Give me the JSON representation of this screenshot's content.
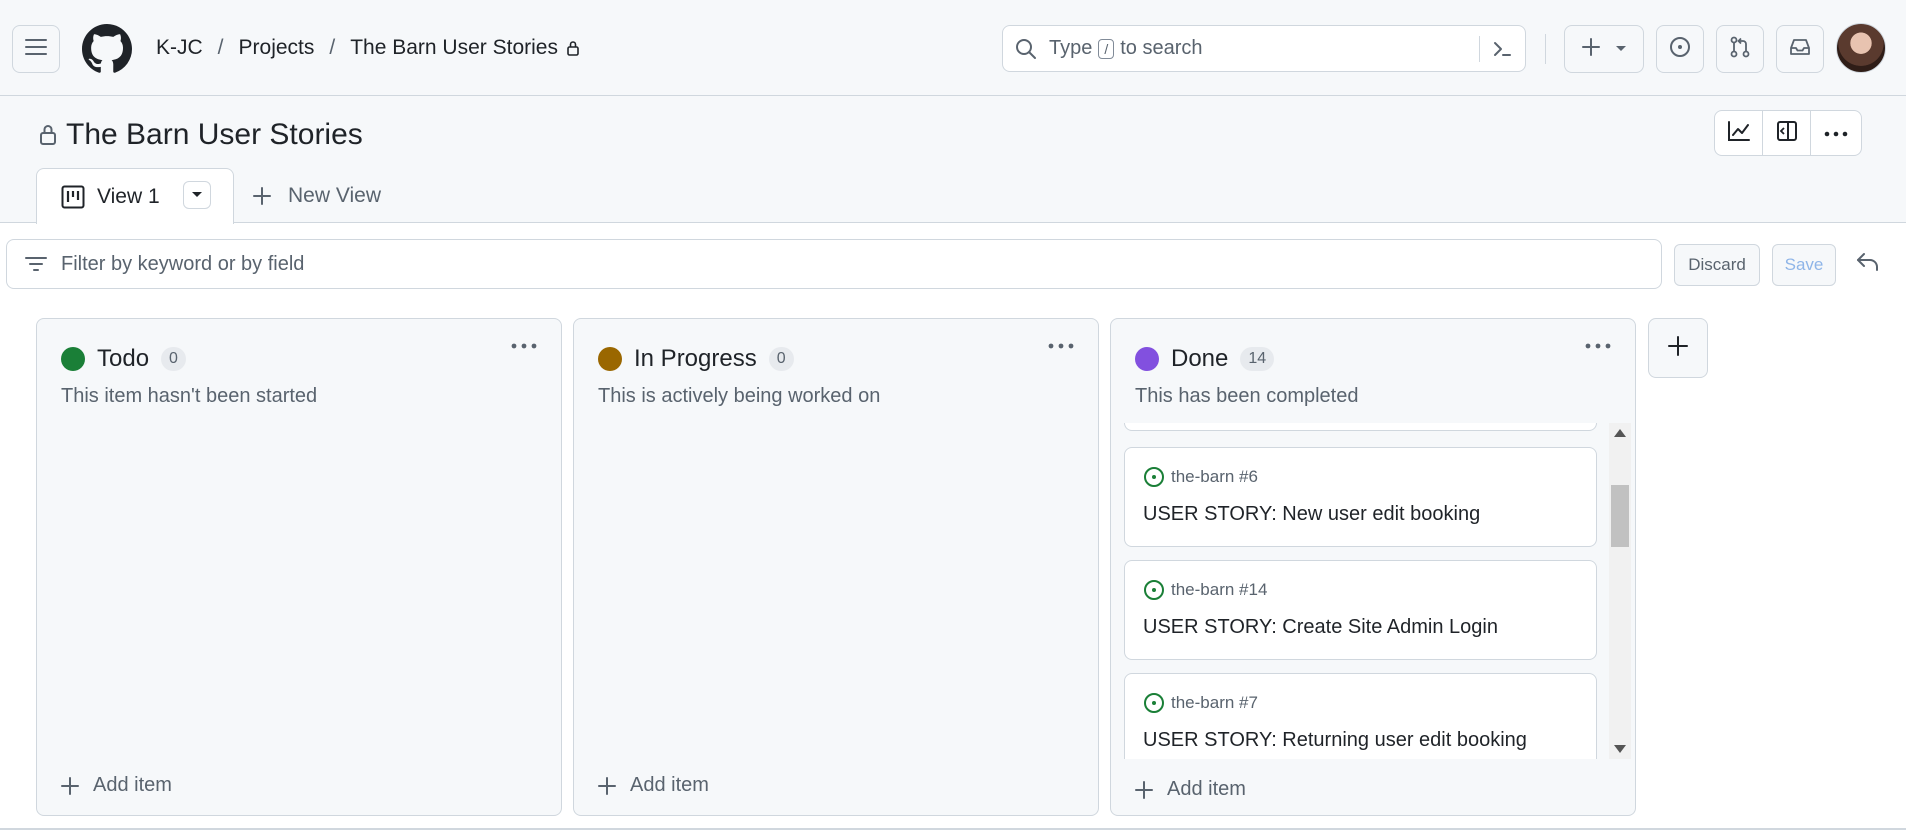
{
  "header": {
    "breadcrumbs": [
      {
        "label": "K-JC"
      },
      {
        "label": "Projects"
      },
      {
        "label": "The Barn User Stories"
      }
    ],
    "separator": "/",
    "search": {
      "prefix": "Type",
      "key": "/",
      "suffix": "to search"
    },
    "icons": {
      "menu": "hamburger-icon",
      "logo": "github-logo",
      "search": "search-icon",
      "command": "terminal-icon",
      "create": "plus-icon",
      "issues": "issue-opened-icon",
      "pulls": "git-pull-request-icon",
      "inbox": "inbox-icon"
    }
  },
  "project": {
    "title": "The Barn User Stories",
    "views": [
      {
        "label": "View 1",
        "active": true
      }
    ],
    "new_view_label": "New View"
  },
  "filter": {
    "placeholder": "Filter by keyword or by field",
    "discard_label": "Discard",
    "save_label": "Save"
  },
  "board": {
    "columns": [
      {
        "name": "Todo",
        "count": "0",
        "color": "#1a7f37",
        "description": "This item hasn't been started",
        "add_label": "Add item",
        "cards": []
      },
      {
        "name": "In Progress",
        "count": "0",
        "color": "#9a6700",
        "description": "This is actively being worked on",
        "add_label": "Add item",
        "cards": []
      },
      {
        "name": "Done",
        "count": "14",
        "color": "#8250df",
        "description": "This has been completed",
        "add_label": "Add item",
        "cards": [
          {
            "ref": "the-barn #6",
            "title": "USER STORY: New user edit booking"
          },
          {
            "ref": "the-barn #14",
            "title": "USER STORY: Create Site Admin Login"
          },
          {
            "ref": "the-barn #7",
            "title": "USER STORY: Returning user edit booking"
          }
        ]
      }
    ]
  },
  "colors": {
    "accent_open": "#1a7f37",
    "border": "#d0d7de",
    "muted": "#59636e"
  }
}
